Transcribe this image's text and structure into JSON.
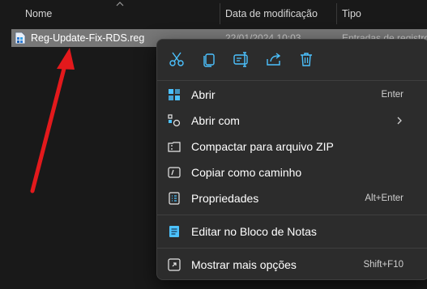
{
  "columns": {
    "name": "Nome",
    "modified": "Data de modificação",
    "type": "Tipo"
  },
  "file": {
    "name": "Reg-Update-Fix-RDS.reg",
    "modified": "22/01/2024 10:03",
    "type": "Entradas de registro"
  },
  "toolbar": [
    "scissors-icon",
    "copy-icon",
    "rename-icon",
    "share-icon",
    "trash-icon"
  ],
  "menu": {
    "open": {
      "label": "Abrir",
      "shortcut": "Enter"
    },
    "open_with": {
      "label": "Abrir com"
    },
    "zip": {
      "label": "Compactar para arquivo ZIP"
    },
    "copy_path": {
      "label": "Copiar como caminho"
    },
    "properties": {
      "label": "Propriedades",
      "shortcut": "Alt+Enter"
    },
    "notepad": {
      "label": "Editar no Bloco de Notas"
    },
    "more": {
      "label": "Mostrar mais opções",
      "shortcut": "Shift+F10"
    }
  },
  "colors": {
    "background": "#191919",
    "menu_bg": "#2c2c2c",
    "selection": "#777777",
    "annotation_arrow": "#e3191c",
    "accent": "#4cc2ff"
  }
}
